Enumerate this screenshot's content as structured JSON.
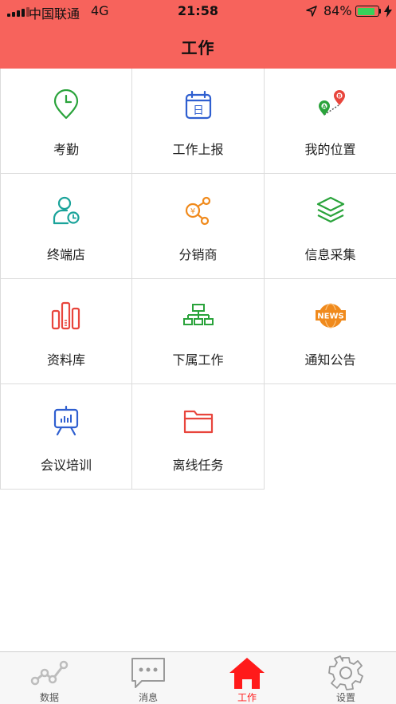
{
  "status_bar": {
    "carrier": "中国联通",
    "network": "4G",
    "time": "21:58",
    "battery": "84%",
    "battery_level": 0.84
  },
  "header": {
    "title": "工作"
  },
  "grid": [
    {
      "label": "考勤",
      "icon": "clock-pin-icon",
      "color": "#2aa33b"
    },
    {
      "label": "工作上报",
      "icon": "calendar-icon",
      "color": "#2f5fd0"
    },
    {
      "label": "我的位置",
      "icon": "map-route-icon",
      "color": "#2aa33b"
    },
    {
      "label": "终端店",
      "icon": "user-clock-icon",
      "color": "#1aa39a"
    },
    {
      "label": "分销商",
      "icon": "distributor-icon",
      "color": "#f08a1c"
    },
    {
      "label": "信息采集",
      "icon": "layers-icon",
      "color": "#2aa33b"
    },
    {
      "label": "资料库",
      "icon": "library-icon",
      "color": "#e8453c"
    },
    {
      "label": "下属工作",
      "icon": "org-chart-icon",
      "color": "#2aa33b"
    },
    {
      "label": "通知公告",
      "icon": "news-icon",
      "color": "#f08a1c"
    },
    {
      "label": "会议培训",
      "icon": "presentation-icon",
      "color": "#2f5fd0"
    },
    {
      "label": "离线任务",
      "icon": "folder-icon",
      "color": "#e8453c"
    }
  ],
  "tabbar": {
    "active_color": "#ff1a1a",
    "items": [
      {
        "label": "数据",
        "icon": "chart-line-icon"
      },
      {
        "label": "消息",
        "icon": "message-icon"
      },
      {
        "label": "工作",
        "icon": "home-icon",
        "active": true
      },
      {
        "label": "设置",
        "icon": "gear-icon"
      }
    ]
  }
}
